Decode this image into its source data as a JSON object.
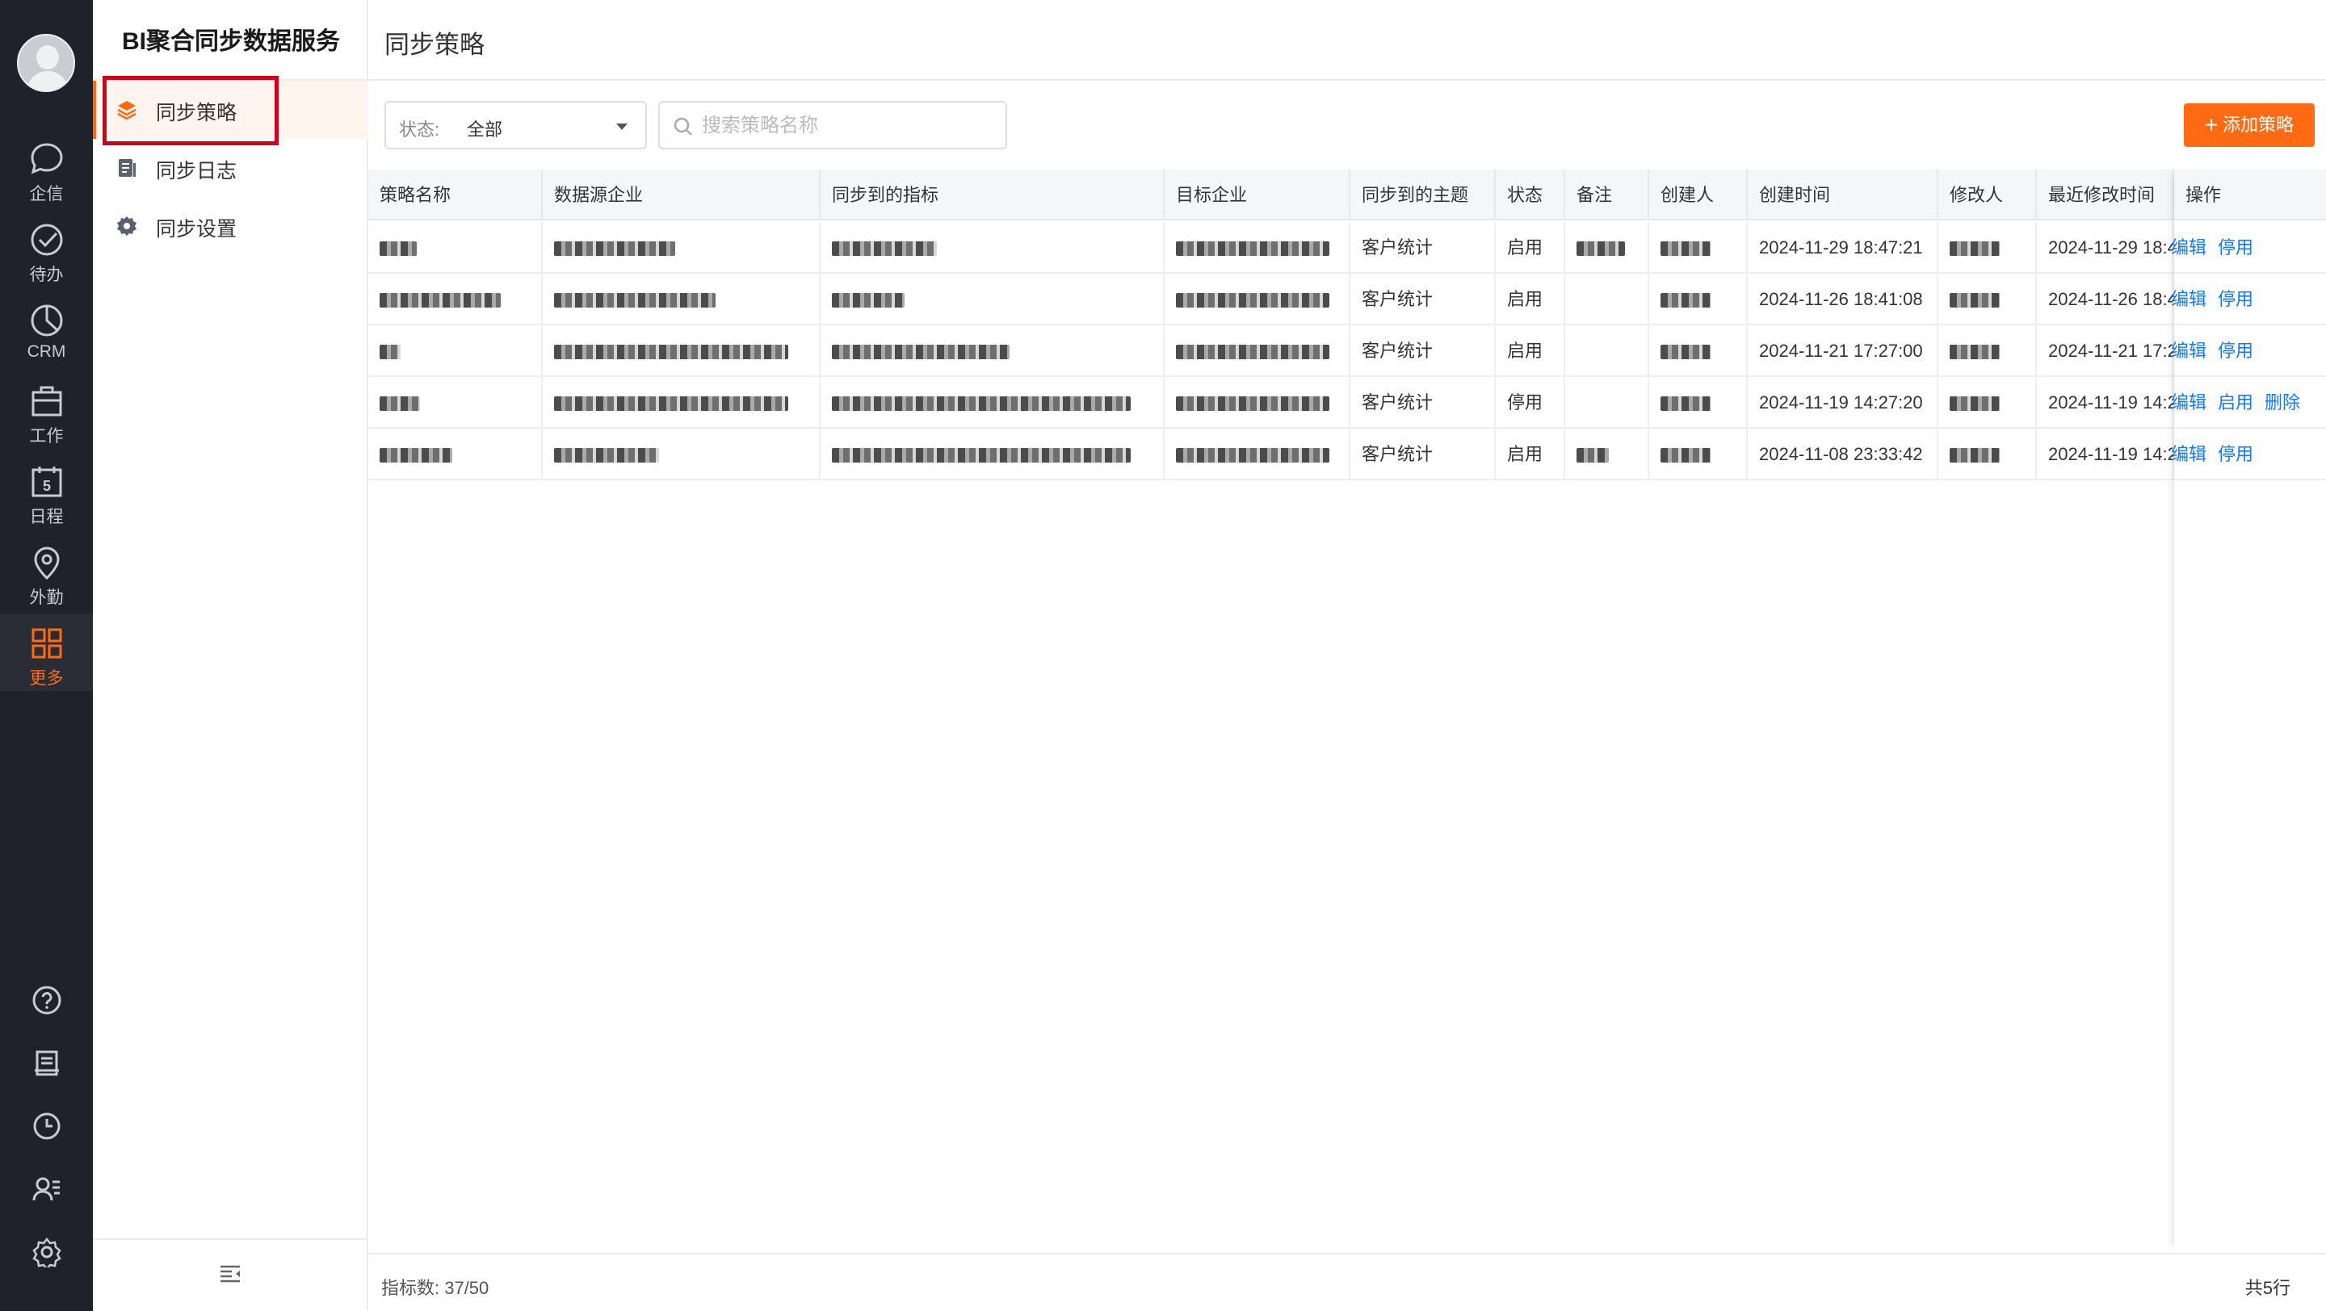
{
  "rail": {
    "items": [
      {
        "label": "企信",
        "icon": "chat-icon"
      },
      {
        "label": "待办",
        "icon": "check-circle-icon"
      },
      {
        "label": "CRM",
        "icon": "pie-chart-icon"
      },
      {
        "label": "工作",
        "icon": "briefcase-icon"
      },
      {
        "label": "日程",
        "icon": "calendar-icon",
        "badge": "5"
      },
      {
        "label": "外勤",
        "icon": "location-pin-icon"
      },
      {
        "label": "更多",
        "icon": "grid-icon",
        "active": true
      }
    ],
    "bottom_icons": [
      "help-icon",
      "notes-icon",
      "clock-icon",
      "contacts-icon",
      "settings-icon"
    ]
  },
  "sidebar": {
    "title": "BI聚合同步数据服务",
    "items": [
      {
        "label": "同步策略",
        "icon": "layers-icon",
        "active": true
      },
      {
        "label": "同步日志",
        "icon": "log-icon"
      },
      {
        "label": "同步设置",
        "icon": "gear-icon"
      }
    ]
  },
  "main": {
    "title": "同步策略",
    "filter": {
      "label": "状态:",
      "value": "全部"
    },
    "search": {
      "placeholder": "搜索策略名称"
    },
    "add_button": "添加策略",
    "columns": [
      "策略名称",
      "数据源企业",
      "同步到的指标",
      "目标企业",
      "同步到的主题",
      "状态",
      "备注",
      "创建人",
      "创建时间",
      "修改人",
      "最近修改时间",
      "操作"
    ],
    "rows": [
      {
        "theme": "客户统计",
        "status": "启用",
        "created": "2024-11-29 18:47:21",
        "modified": "2024-11-29 18:4",
        "ops": [
          "编辑",
          "停用"
        ]
      },
      {
        "theme": "客户统计",
        "status": "启用",
        "created": "2024-11-26 18:41:08",
        "modified": "2024-11-26 18:4",
        "ops": [
          "编辑",
          "停用"
        ]
      },
      {
        "theme": "客户统计",
        "status": "启用",
        "created": "2024-11-21 17:27:00",
        "modified": "2024-11-21 17:2",
        "ops": [
          "编辑",
          "停用"
        ]
      },
      {
        "theme": "客户统计",
        "status": "停用",
        "created": "2024-11-19 14:27:20",
        "modified": "2024-11-19 14:2",
        "ops": [
          "编辑",
          "启用",
          "删除"
        ]
      },
      {
        "theme": "客户统计",
        "status": "启用",
        "created": "2024-11-08 23:33:42",
        "modified": "2024-11-19 14:2",
        "ops": [
          "编辑",
          "停用"
        ]
      }
    ],
    "footer_left": "指标数:  37/50",
    "footer_right": "共5行"
  },
  "colors": {
    "accent": "#ff6a13",
    "link": "#1677ff",
    "rail_bg": "#1f222b",
    "highlight": "#d0021b"
  }
}
